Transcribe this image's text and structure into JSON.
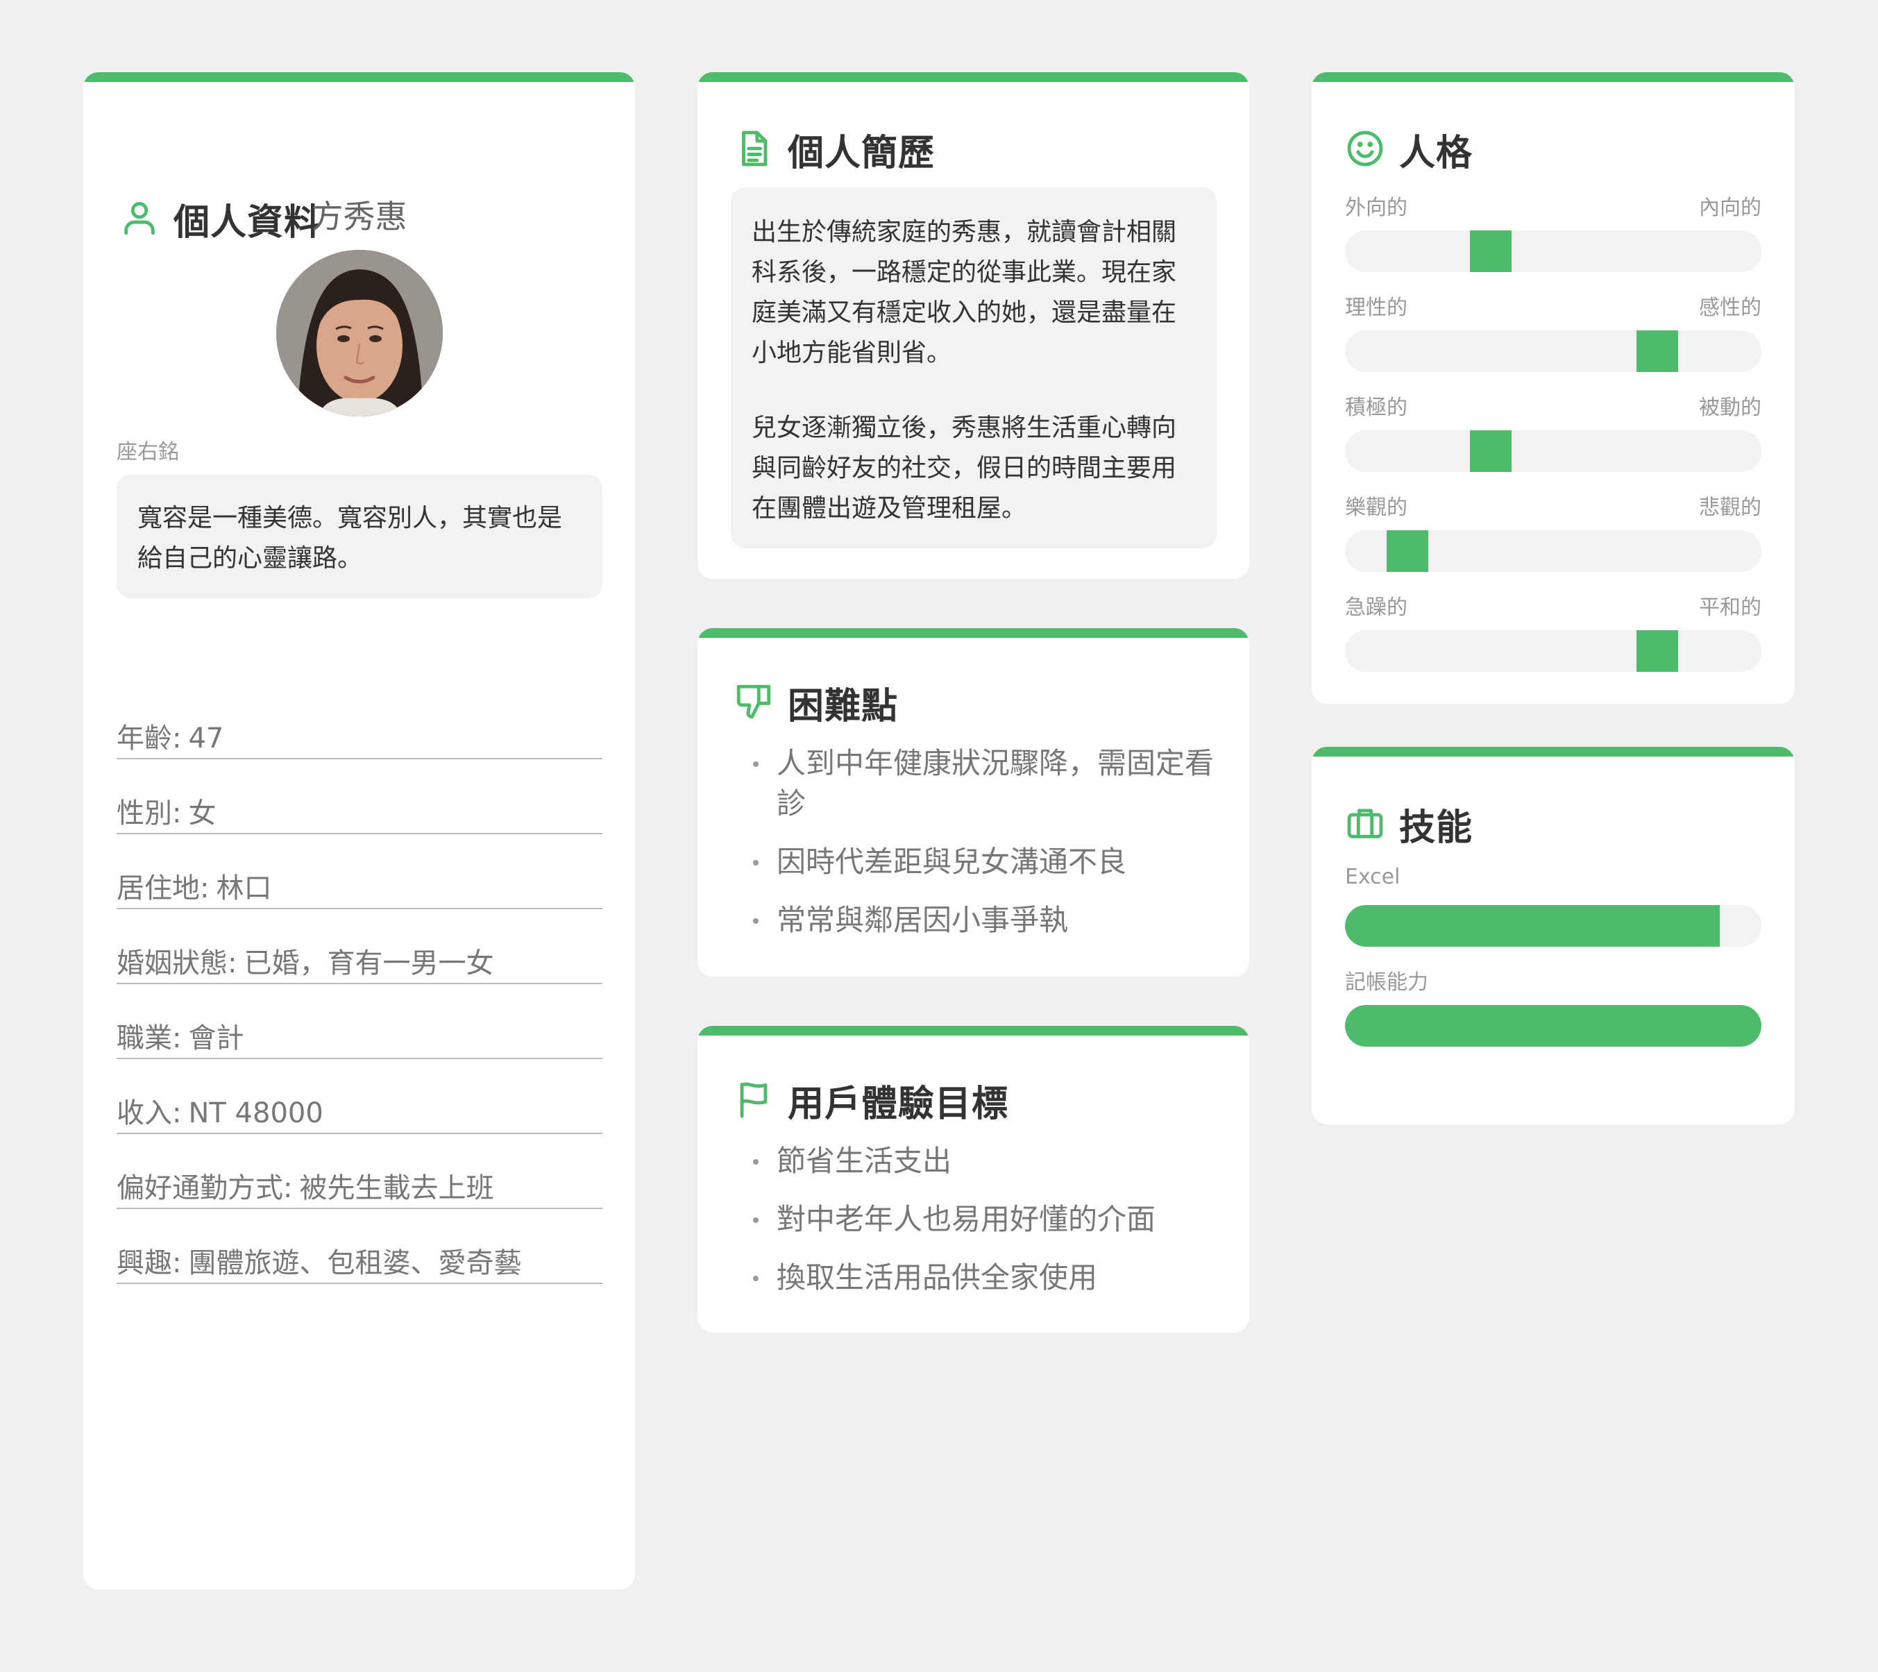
{
  "accent_color": "#4cbb6a",
  "profile": {
    "title": "個人資料",
    "icon": "user-icon",
    "name": "方秀惠",
    "motto_label": "座右銘",
    "motto": "寬容是一種美德。寬容別人，其實也是給自己的心靈讓路。",
    "fields": [
      {
        "label": "年齡:",
        "value": "47"
      },
      {
        "label": "性別:",
        "value": "女"
      },
      {
        "label": "居住地:",
        "value": "林口"
      },
      {
        "label": "婚姻狀態:",
        "value": "已婚，育有一男一女"
      },
      {
        "label": "職業:",
        "value": "會計"
      },
      {
        "label": "收入:",
        "value": "NT 48000"
      },
      {
        "label": "偏好通勤方式:",
        "value": "被先生載去上班"
      },
      {
        "label": "興趣:",
        "value": "團體旅遊、包租婆、愛奇藝"
      }
    ]
  },
  "bio": {
    "title": "個人簡歷",
    "icon": "document-icon",
    "paragraphs": [
      "出生於傳統家庭的秀惠，就讀會計相關科系後，一路穩定的從事此業。現在家庭美滿又有穩定收入的她，還是盡量在小地方能省則省。",
      "兒女逐漸獨立後，秀惠將生活重心轉向與同齡好友的社交，假日的時間主要用在團體出遊及管理租屋。"
    ]
  },
  "pain_points": {
    "title": "困難點",
    "icon": "thumbs-down-icon",
    "items": [
      "人到中年健康狀況驟降，需固定看診",
      "因時代差距與兒女溝通不良",
      "常常與鄰居因小事爭執"
    ]
  },
  "goals": {
    "title": "用戶體驗目標",
    "icon": "flag-icon",
    "items": [
      "節省生活支出",
      "對中老年人也易用好懂的介面",
      "換取生活用品供全家使用"
    ]
  },
  "personality": {
    "title": "人格",
    "icon": "smile-icon",
    "traits": [
      {
        "left": "外向的",
        "right": "內向的",
        "level": 0.35
      },
      {
        "left": "理性的",
        "right": "感性的",
        "level": 0.75
      },
      {
        "left": "積極的",
        "right": "被動的",
        "level": 0.35
      },
      {
        "left": "樂觀的",
        "right": "悲觀的",
        "level": 0.15
      },
      {
        "left": "急躁的",
        "right": "平和的",
        "level": 0.75
      }
    ]
  },
  "skills": {
    "title": "技能",
    "icon": "briefcase-icon",
    "items": [
      {
        "label": "Excel",
        "level": 0.9
      },
      {
        "label": "記帳能力",
        "level": 1.0
      }
    ]
  }
}
